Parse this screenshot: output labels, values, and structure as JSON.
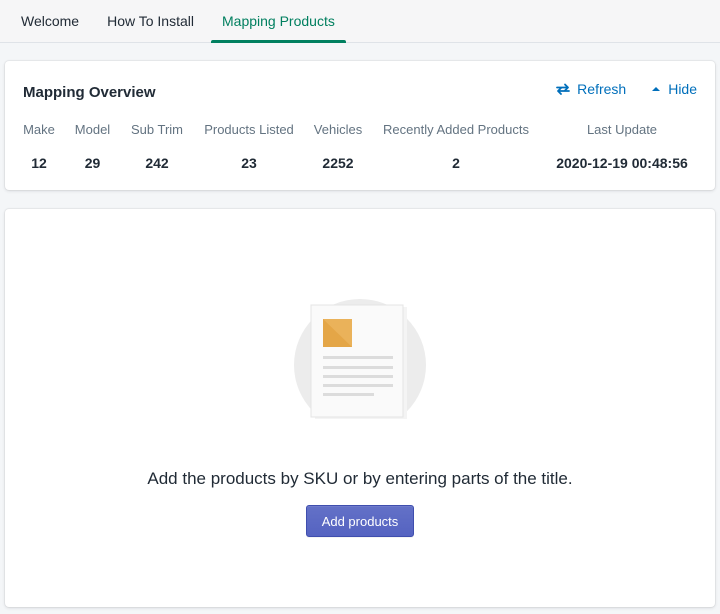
{
  "tabs": [
    {
      "label": "Welcome"
    },
    {
      "label": "How To Install"
    },
    {
      "label": "Mapping Products"
    }
  ],
  "overview": {
    "title": "Mapping Overview",
    "refresh_label": "Refresh",
    "hide_label": "Hide",
    "refresh_icon": "refresh-icon",
    "hide_icon": "caret-up-icon",
    "headers": [
      "Make",
      "Model",
      "Sub Trim",
      "Products Listed",
      "Vehicles",
      "Recently Added Products",
      "Last Update"
    ],
    "values": [
      "12",
      "29",
      "242",
      "23",
      "2252",
      "2",
      "2020-12-19 00:48:56"
    ]
  },
  "empty_state": {
    "message": "Add the products by SKU or by entering parts of the title.",
    "button_label": "Add products",
    "illustration": "document-icon"
  },
  "colors": {
    "accent": "#008060",
    "link": "#006fbb",
    "primary_button": "#5c6ac4"
  }
}
